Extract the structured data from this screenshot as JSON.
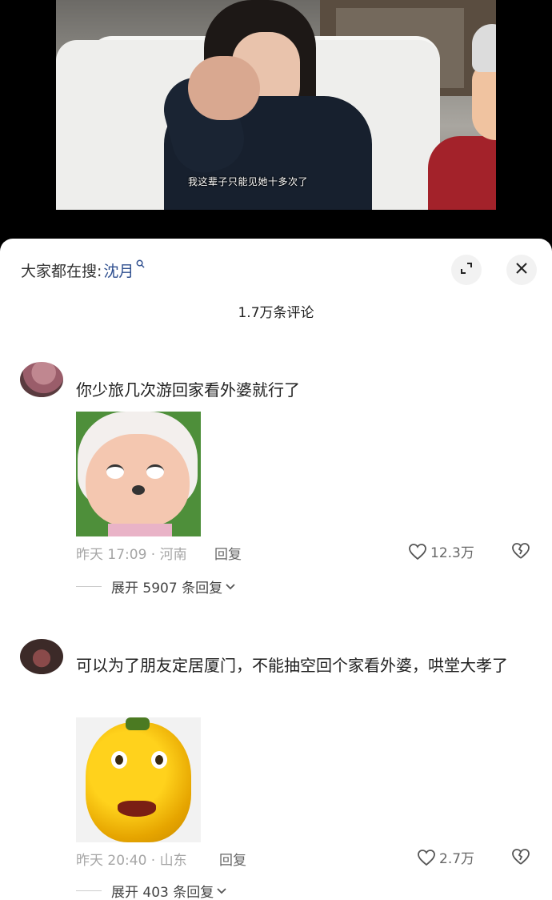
{
  "video": {
    "subtitle": "我这辈子只能见她十多次了"
  },
  "panel": {
    "search_prefix": "大家都在搜:",
    "search_term": "沈月",
    "comment_count": "1.7万条评论"
  },
  "comments": [
    {
      "text": "你少旅几次游回家看外婆就行了",
      "time_location": "昨天 17:09 · 河南",
      "reply_label": "回复",
      "likes": "12.3万",
      "expand_label": "展开 5907 条回复"
    },
    {
      "text": "可以为了朋友定居厦门，不能抽空回个家看外婆，哄堂大孝了",
      "time_location": "昨天 20:40 · 山东",
      "reply_label": "回复",
      "likes": "2.7万",
      "expand_label": "展开 403 条回复"
    }
  ],
  "icons": {
    "search": "search-icon",
    "expand": "expand-icon",
    "close": "close-icon",
    "like": "heart-icon",
    "dislike": "broken-heart-icon",
    "chevron": "chevron-down-icon"
  }
}
